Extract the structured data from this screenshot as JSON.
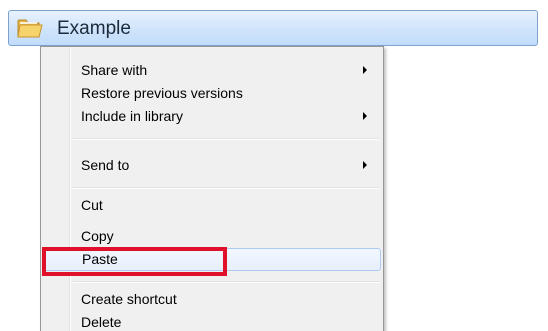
{
  "folder": {
    "name": "Example",
    "icon": "folder-icon"
  },
  "menu": {
    "items": [
      {
        "label": "Share with",
        "has_submenu": true
      },
      {
        "label": "Restore previous versions",
        "has_submenu": false
      },
      {
        "label": "Include in library",
        "has_submenu": true
      },
      {
        "label": "Send to",
        "has_submenu": true
      },
      {
        "label": "Cut",
        "has_submenu": false
      },
      {
        "label": "Copy",
        "has_submenu": false
      },
      {
        "label": "Paste",
        "has_submenu": false
      },
      {
        "label": "Create shortcut",
        "has_submenu": false
      },
      {
        "label": "Delete",
        "has_submenu": false
      }
    ],
    "highlighted_item": "Paste"
  },
  "colors": {
    "highlight_box": "#e0102a",
    "selection_border": "#7da2ce",
    "menu_background": "#f0f0f0"
  }
}
